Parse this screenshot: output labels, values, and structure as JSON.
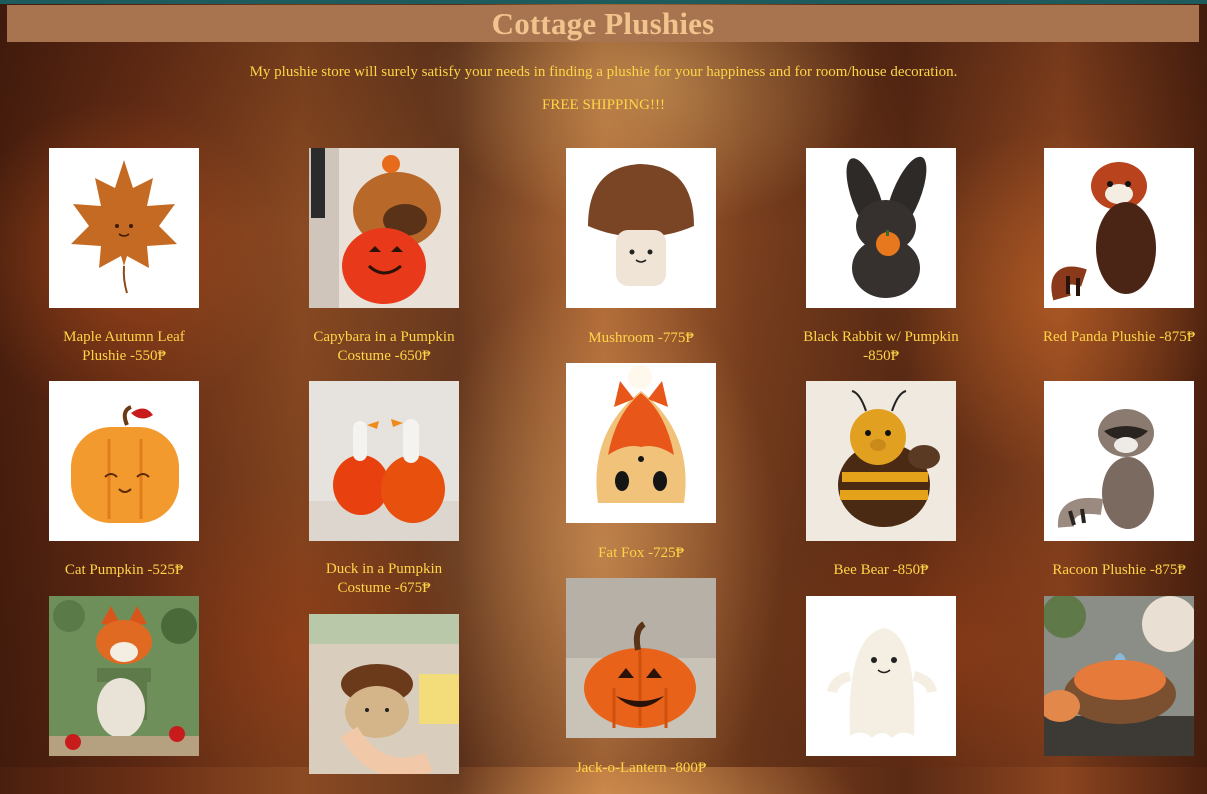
{
  "store": {
    "title": "Cottage Plushies",
    "intro": "My plushie store will surely satisfy your needs in finding a plushie for your happiness and for room/house decoration.",
    "shipping": "FREE SHIPPING!!!"
  },
  "products": [
    {
      "name": "Maple Autumn Leaf Plushie -550₱"
    },
    {
      "name": "Capybara in a Pumpkin Costume -650₱"
    },
    {
      "name": "Mushroom -775₱"
    },
    {
      "name": "Black Rabbit w/ Pumpkin -850₱"
    },
    {
      "name": "Red Panda Plushie -875₱"
    },
    {
      "name": "Cat Pumpkin -525₱"
    },
    {
      "name": "Duck in a Pumpkin Costume -675₱"
    },
    {
      "name": "Fat Fox -725₱"
    },
    {
      "name": "Bee Bear -850₱"
    },
    {
      "name": "Racoon Plushie -875₱"
    },
    {
      "name": ""
    },
    {
      "name": ""
    },
    {
      "name": "Jack-o-Lantern -800₱"
    },
    {
      "name": ""
    },
    {
      "name": ""
    }
  ],
  "colors": {
    "title_bar": "#a8734f",
    "title_text": "#f1c48e",
    "body_text": "#ffd447"
  }
}
